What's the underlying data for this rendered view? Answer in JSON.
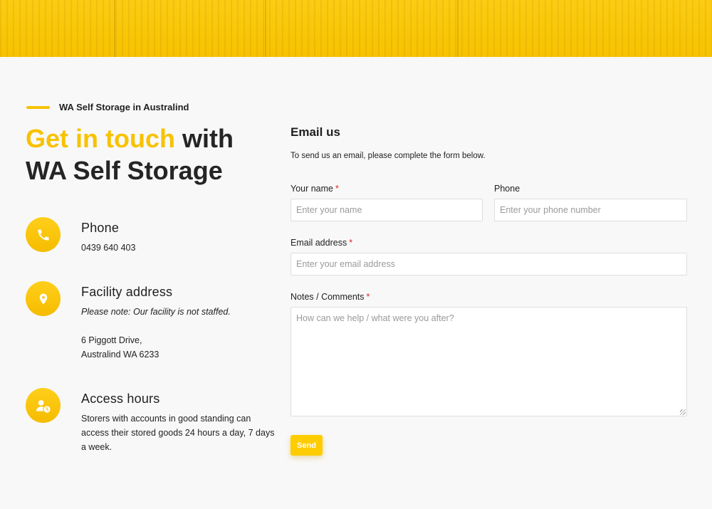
{
  "eyebrow": "WA Self Storage in Australind",
  "headline": {
    "highlight": "Get in touch",
    "rest_line1": " with",
    "line2": "WA Self Storage"
  },
  "phone": {
    "icon": "phone-icon",
    "title": "Phone",
    "number": "0439 640 403"
  },
  "address": {
    "icon": "location-pin-icon",
    "title": "Facility address",
    "note": "Please note: Our facility is not staffed.",
    "line1": "6 Piggott Drive,",
    "line2": "Australind WA 6233"
  },
  "hours": {
    "icon": "user-clock-icon",
    "title": "Access hours",
    "text": "Storers with accounts in good standing can access their stored goods 24 hours a day, 7 days a week."
  },
  "form": {
    "title": "Email us",
    "intro": "To send us an email, please complete the form below.",
    "required_mark": "*",
    "name_label": "Your name",
    "name_placeholder": "Enter your name",
    "phone_label": "Phone",
    "phone_placeholder": "Enter your phone number",
    "email_label": "Email address",
    "email_placeholder": "Enter your email address",
    "notes_label": "Notes / Comments",
    "notes_placeholder": "How can we help / what were you after?",
    "send_label": "Send"
  },
  "colors": {
    "accent": "#f7c200",
    "required": "#e02424",
    "background": "#f8f8f8"
  }
}
